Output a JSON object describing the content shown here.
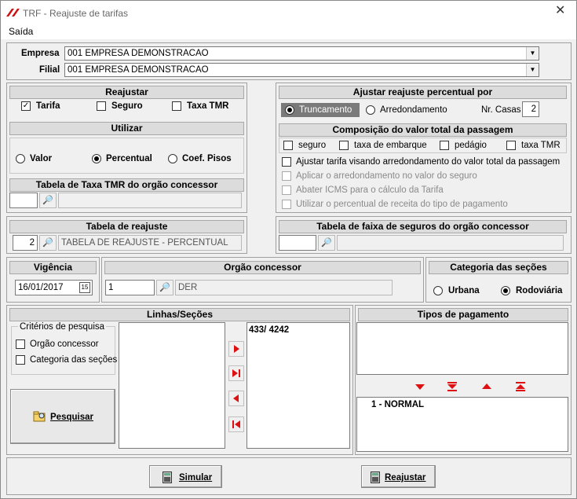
{
  "window": {
    "title": "TRF - Reajuste de tarifas",
    "menu": "Saída"
  },
  "empresa": {
    "label": "Empresa",
    "value": "001 EMPRESA DEMONSTRACAO"
  },
  "filial": {
    "label": "Filial",
    "value": "001 EMPRESA DEMONSTRACAO"
  },
  "reajustar": {
    "title": "Reajustar",
    "tarifa": "Tarifa",
    "seguro": "Seguro",
    "taxa_tmr": "Taxa TMR",
    "tarifa_checked": true
  },
  "utilizar": {
    "title": "Utilizar",
    "valor": "Valor",
    "percentual": "Percentual",
    "coef": "Coef. Pisos",
    "selected": "Percentual"
  },
  "tabela_tmr": {
    "title": "Tabela de Taxa TMR do orgão concessor",
    "code": "",
    "desc": ""
  },
  "ajustar": {
    "title": "Ajustar reajuste percentual por",
    "truncamento": "Truncamento",
    "arredondamento": "Arredondamento",
    "nr_casas_label": "Nr. Casas",
    "nr_casas": "2",
    "selected": "Truncamento"
  },
  "composicao": {
    "title": "Composição do valor total da passagem",
    "seguro": "seguro",
    "taxa_embarque": "taxa de embarque",
    "pedagio": "pedágio",
    "taxa_tmr": "taxa TMR"
  },
  "opcoes": {
    "ajustar_tarifa": "Ajustar tarifa visando arredondamento do valor total da passagem",
    "aplicar_arred": "Aplicar o arredondamento no valor do seguro",
    "abater_icms": "Abater ICMS para o cálculo da Tarifa",
    "utilizar_perc": "Utilizar o percentual de receita do tipo de pagamento"
  },
  "tabela_reajuste": {
    "title": "Tabela de reajuste",
    "code": "2",
    "desc": "TABELA DE REAJUSTE - PERCENTUAL"
  },
  "tabela_seguros": {
    "title": "Tabela de faixa de seguros do orgão concessor",
    "code": "",
    "desc": ""
  },
  "vigencia": {
    "title": "Vigência",
    "date": "16/01/2017"
  },
  "orgao": {
    "title": "Orgão concessor",
    "code": "1",
    "desc": "DER"
  },
  "categoria": {
    "title": "Categoria das seções",
    "urbana": "Urbana",
    "rodoviaria": "Rodoviária",
    "selected": "Rodoviária"
  },
  "linhas": {
    "title": "Linhas/Seções",
    "criterios": "Critérios de pesquisa",
    "orgao_concessor": "Orgão concessor",
    "categoria_secoes": "Categoria das seções",
    "pesquisar": "Pesquisar",
    "selected_items": [
      "433/ 4242"
    ]
  },
  "tipos_pagamento": {
    "title": "Tipos de pagamento",
    "selected_items": [
      "1 - NORMAL"
    ]
  },
  "footer": {
    "simular": "Simular",
    "reajustar": "Reajustar"
  },
  "colors": {
    "accent": "#cc1111",
    "header_bg": "#dcdcdc",
    "selection": "#7a7a7a"
  }
}
